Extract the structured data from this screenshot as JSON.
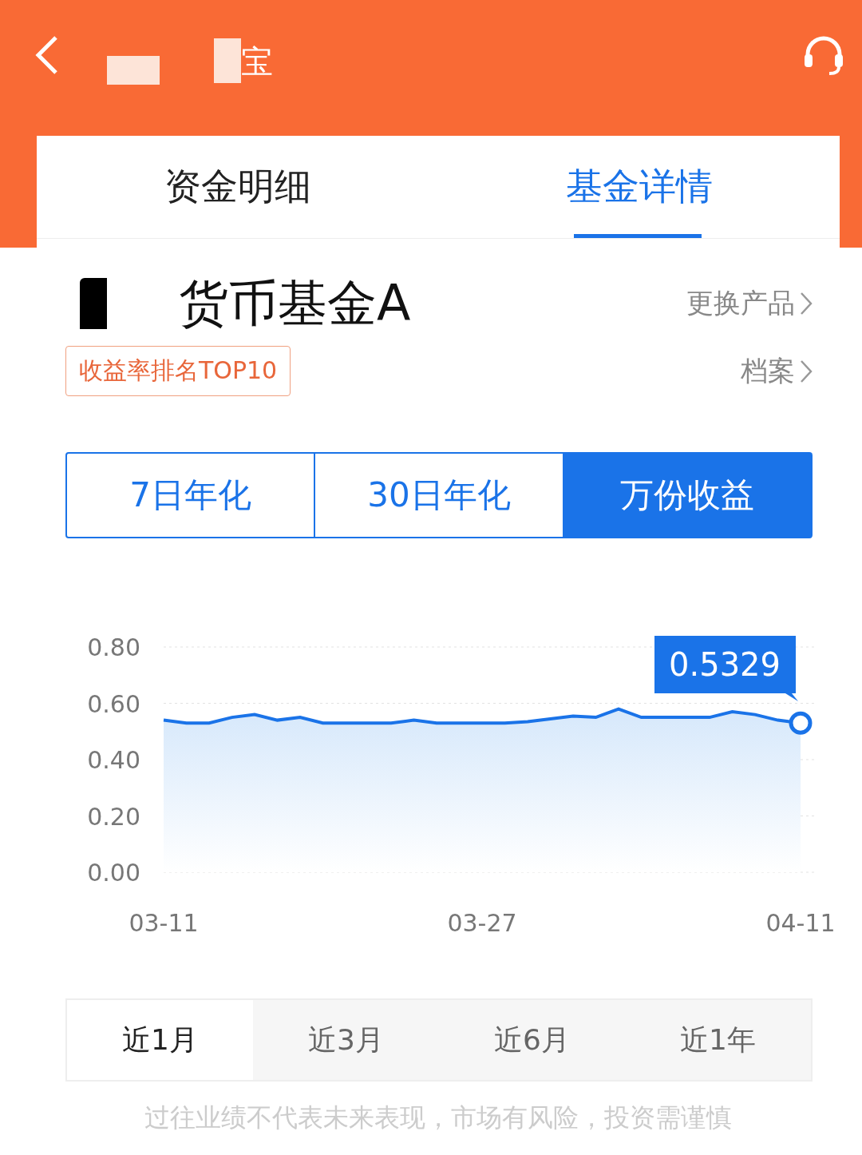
{
  "header": {
    "title": "宝"
  },
  "tabs": [
    {
      "label": "资金明细",
      "selected": false
    },
    {
      "label": "基金详情",
      "selected": true
    }
  ],
  "fund": {
    "name": "货币基金A",
    "change_link": "更换产品",
    "badge": "收益率排名TOP10",
    "profile_link": "档案"
  },
  "metrics": [
    {
      "label": "7日年化",
      "selected": false
    },
    {
      "label": "30日年化",
      "selected": false
    },
    {
      "label": "万份收益",
      "selected": true
    }
  ],
  "chart": {
    "tooltip": "0.5329",
    "chart_data": {
      "type": "area",
      "categories": [
        "03-11",
        null,
        null,
        null,
        null,
        null,
        null,
        null,
        null,
        null,
        null,
        null,
        null,
        null,
        "03-27",
        null,
        null,
        null,
        null,
        null,
        null,
        null,
        null,
        null,
        null,
        null,
        null,
        null,
        "04-11"
      ],
      "series": [
        {
          "color": "#1a73e8",
          "values": [
            0.54,
            0.53,
            0.53,
            0.55,
            0.56,
            0.54,
            0.55,
            0.53,
            0.53,
            0.53,
            0.53,
            0.54,
            0.53,
            0.53,
            0.53,
            0.53,
            0.535,
            0.545,
            0.555,
            0.55,
            0.58,
            0.55,
            0.55,
            0.55,
            0.55,
            0.57,
            0.56,
            0.54,
            0.53
          ]
        }
      ],
      "ylim": [
        0,
        0.8
      ],
      "yticks": [
        {
          "value": 0,
          "label": "0.00"
        },
        {
          "value": 0.2,
          "label": "0.20"
        },
        {
          "value": 0.4,
          "label": "0.40"
        },
        {
          "value": 0.6,
          "label": "0.60"
        },
        {
          "value": 0.8,
          "label": "0.80"
        }
      ],
      "grid": true
    }
  },
  "periods": [
    {
      "label": "近1月",
      "selected": true
    },
    {
      "label": "近3月",
      "selected": false
    },
    {
      "label": "近6月",
      "selected": false
    },
    {
      "label": "近1年",
      "selected": false
    }
  ],
  "disclaimer": "过往业绩不代表未来表现，市场有风险，投资需谨慎"
}
